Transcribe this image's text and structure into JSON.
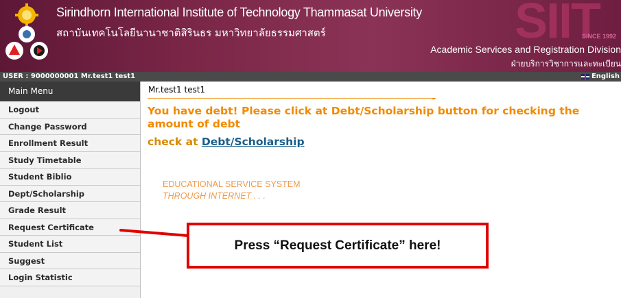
{
  "header": {
    "title_en": "Sirindhorn International Institute of Technology Thammasat University",
    "title_th": "สถาบันเทคโนโลยีนานาชาติสิรินธร มหาวิทยาลัยธรรมศาสตร์",
    "logo_text": "SIIT",
    "logo_since": "SINCE 1992",
    "subtitle_en": "Academic Services and Registration Division",
    "subtitle_th": "ฝ่ายบริการวิชาการและทะเบียน"
  },
  "userbar": {
    "user": "USER : 9000000001 Mr.test1 test1",
    "language": "English"
  },
  "sidebar": {
    "title": "Main Menu",
    "items": [
      {
        "label": "Logout"
      },
      {
        "label": "Change Password"
      },
      {
        "label": "Enrollment Result"
      },
      {
        "label": "Study Timetable"
      },
      {
        "label": "Student Biblio"
      },
      {
        "label": "Dept/Scholarship"
      },
      {
        "label": "Grade Result"
      },
      {
        "label": "Request Certificate"
      },
      {
        "label": "Student List"
      },
      {
        "label": "Suggest"
      },
      {
        "label": "Login Statistic"
      }
    ]
  },
  "main": {
    "student_name": "Mr.test1 test1",
    "debt_message": "You have debt! Please click at Debt/Scholarship button for checking the amount of debt",
    "check_prefix": "check at ",
    "check_link": "Debt/Scholarship",
    "edu_line1": "EDUCATIONAL SERVICE SYSTEM",
    "edu_line2": "THROUGH INTERNET . . ."
  },
  "callout": {
    "text": "Press “Request Certificate” here!"
  },
  "colors": {
    "header_bg": "#7a2647",
    "debt_text": "#f28a00",
    "link": "#1a5e8a",
    "callout_border": "#e00000"
  }
}
